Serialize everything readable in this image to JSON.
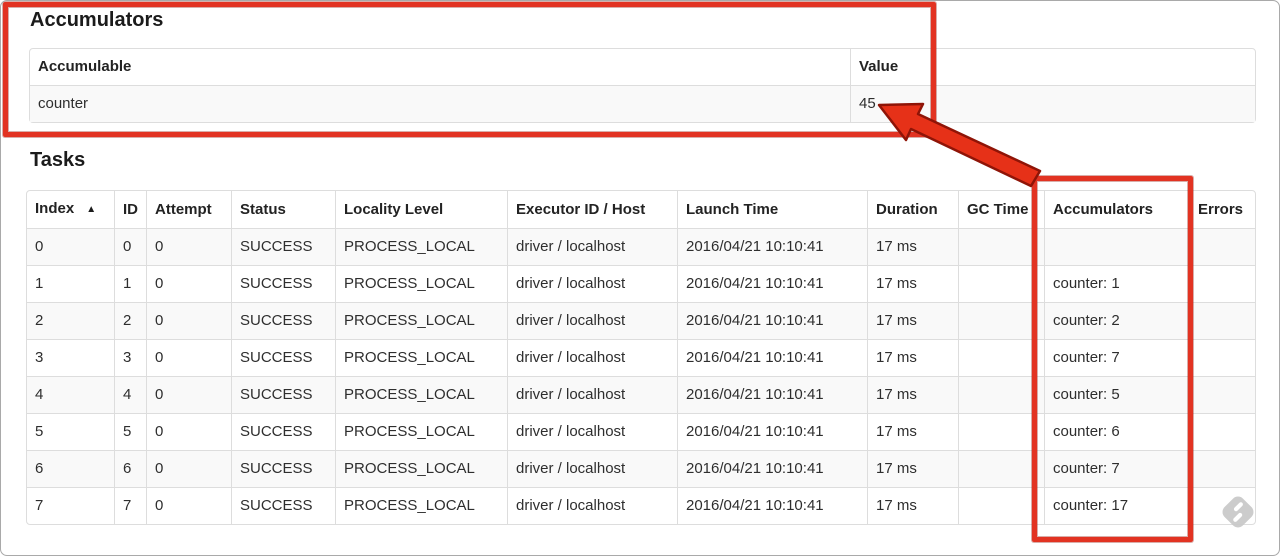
{
  "colors": {
    "annotation_red": "#e23322",
    "annotation_red_outline": "#8f1407",
    "row_stripe": "#f9f9f9",
    "table_border": "#dddddd"
  },
  "icons": {
    "sort_ascending": "▲",
    "watermark": "skitch-logo"
  },
  "accumulators_section": {
    "title": "Accumulators",
    "table": {
      "col_accumulable": "Accumulable",
      "col_value": "Value",
      "rows": [
        {
          "accumulable": "counter",
          "value": "45"
        }
      ]
    }
  },
  "tasks_section": {
    "title": "Tasks",
    "table": {
      "columns": [
        {
          "key": "index",
          "label": "Index",
          "sort": "▲"
        },
        {
          "key": "id",
          "label": "ID"
        },
        {
          "key": "attempt",
          "label": "Attempt"
        },
        {
          "key": "status",
          "label": "Status"
        },
        {
          "key": "locality",
          "label": "Locality Level"
        },
        {
          "key": "executor",
          "label": "Executor ID / Host"
        },
        {
          "key": "launch",
          "label": "Launch Time"
        },
        {
          "key": "duration",
          "label": "Duration"
        },
        {
          "key": "gctime",
          "label": "GC Time"
        },
        {
          "key": "accumulators",
          "label": "Accumulators"
        },
        {
          "key": "errors",
          "label": "Errors"
        }
      ],
      "rows": [
        {
          "index": "0",
          "id": "0",
          "attempt": "0",
          "status": "SUCCESS",
          "locality": "PROCESS_LOCAL",
          "executor": "driver / localhost",
          "launch": "2016/04/21 10:10:41",
          "duration": "17 ms",
          "gctime": "",
          "accumulators": "",
          "errors": ""
        },
        {
          "index": "1",
          "id": "1",
          "attempt": "0",
          "status": "SUCCESS",
          "locality": "PROCESS_LOCAL",
          "executor": "driver / localhost",
          "launch": "2016/04/21 10:10:41",
          "duration": "17 ms",
          "gctime": "",
          "accumulators": "counter: 1",
          "errors": ""
        },
        {
          "index": "2",
          "id": "2",
          "attempt": "0",
          "status": "SUCCESS",
          "locality": "PROCESS_LOCAL",
          "executor": "driver / localhost",
          "launch": "2016/04/21 10:10:41",
          "duration": "17 ms",
          "gctime": "",
          "accumulators": "counter: 2",
          "errors": ""
        },
        {
          "index": "3",
          "id": "3",
          "attempt": "0",
          "status": "SUCCESS",
          "locality": "PROCESS_LOCAL",
          "executor": "driver / localhost",
          "launch": "2016/04/21 10:10:41",
          "duration": "17 ms",
          "gctime": "",
          "accumulators": "counter: 7",
          "errors": ""
        },
        {
          "index": "4",
          "id": "4",
          "attempt": "0",
          "status": "SUCCESS",
          "locality": "PROCESS_LOCAL",
          "executor": "driver / localhost",
          "launch": "2016/04/21 10:10:41",
          "duration": "17 ms",
          "gctime": "",
          "accumulators": "counter: 5",
          "errors": ""
        },
        {
          "index": "5",
          "id": "5",
          "attempt": "0",
          "status": "SUCCESS",
          "locality": "PROCESS_LOCAL",
          "executor": "driver / localhost",
          "launch": "2016/04/21 10:10:41",
          "duration": "17 ms",
          "gctime": "",
          "accumulators": "counter: 6",
          "errors": ""
        },
        {
          "index": "6",
          "id": "6",
          "attempt": "0",
          "status": "SUCCESS",
          "locality": "PROCESS_LOCAL",
          "executor": "driver / localhost",
          "launch": "2016/04/21 10:10:41",
          "duration": "17 ms",
          "gctime": "",
          "accumulators": "counter: 7",
          "errors": ""
        },
        {
          "index": "7",
          "id": "7",
          "attempt": "0",
          "status": "SUCCESS",
          "locality": "PROCESS_LOCAL",
          "executor": "driver / localhost",
          "launch": "2016/04/21 10:10:41",
          "duration": "17 ms",
          "gctime": "",
          "accumulators": "counter: 17",
          "errors": ""
        }
      ]
    }
  }
}
